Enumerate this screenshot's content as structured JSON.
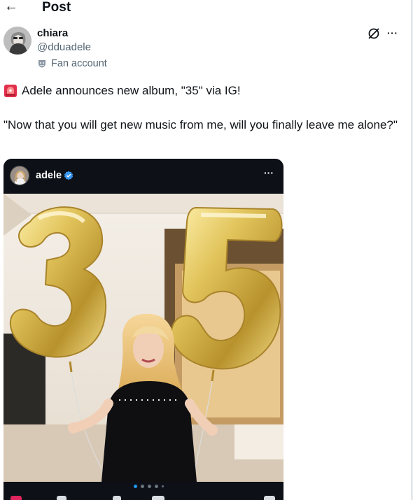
{
  "header": {
    "back_icon": "arrow-left-icon",
    "back_glyph": "←",
    "title": "Post"
  },
  "author": {
    "display_name": "chiara",
    "handle": "@dduadele",
    "label": "Fan account",
    "label_icon": "theater-mask-icon"
  },
  "actions": {
    "grok_icon": "grok-icon",
    "more_icon": "more-dots-icon",
    "more_glyph": "···"
  },
  "tweet": {
    "line1_icon": "police-light-icon",
    "line1": "Adele announces new album, \"35\" via IG!",
    "line2": "\"Now that you will get new music from me, will you finally leave me alone?\""
  },
  "media": {
    "ig_username": "adele",
    "ig_more_glyph": "···",
    "carousel_dots": 5,
    "carousel_active_index": 0,
    "balloon_digits": "35"
  },
  "colors": {
    "text": "#0f1419",
    "secondary": "#536471",
    "accent": "#1d9bf0",
    "balloon_gold": "#d9b94a"
  }
}
